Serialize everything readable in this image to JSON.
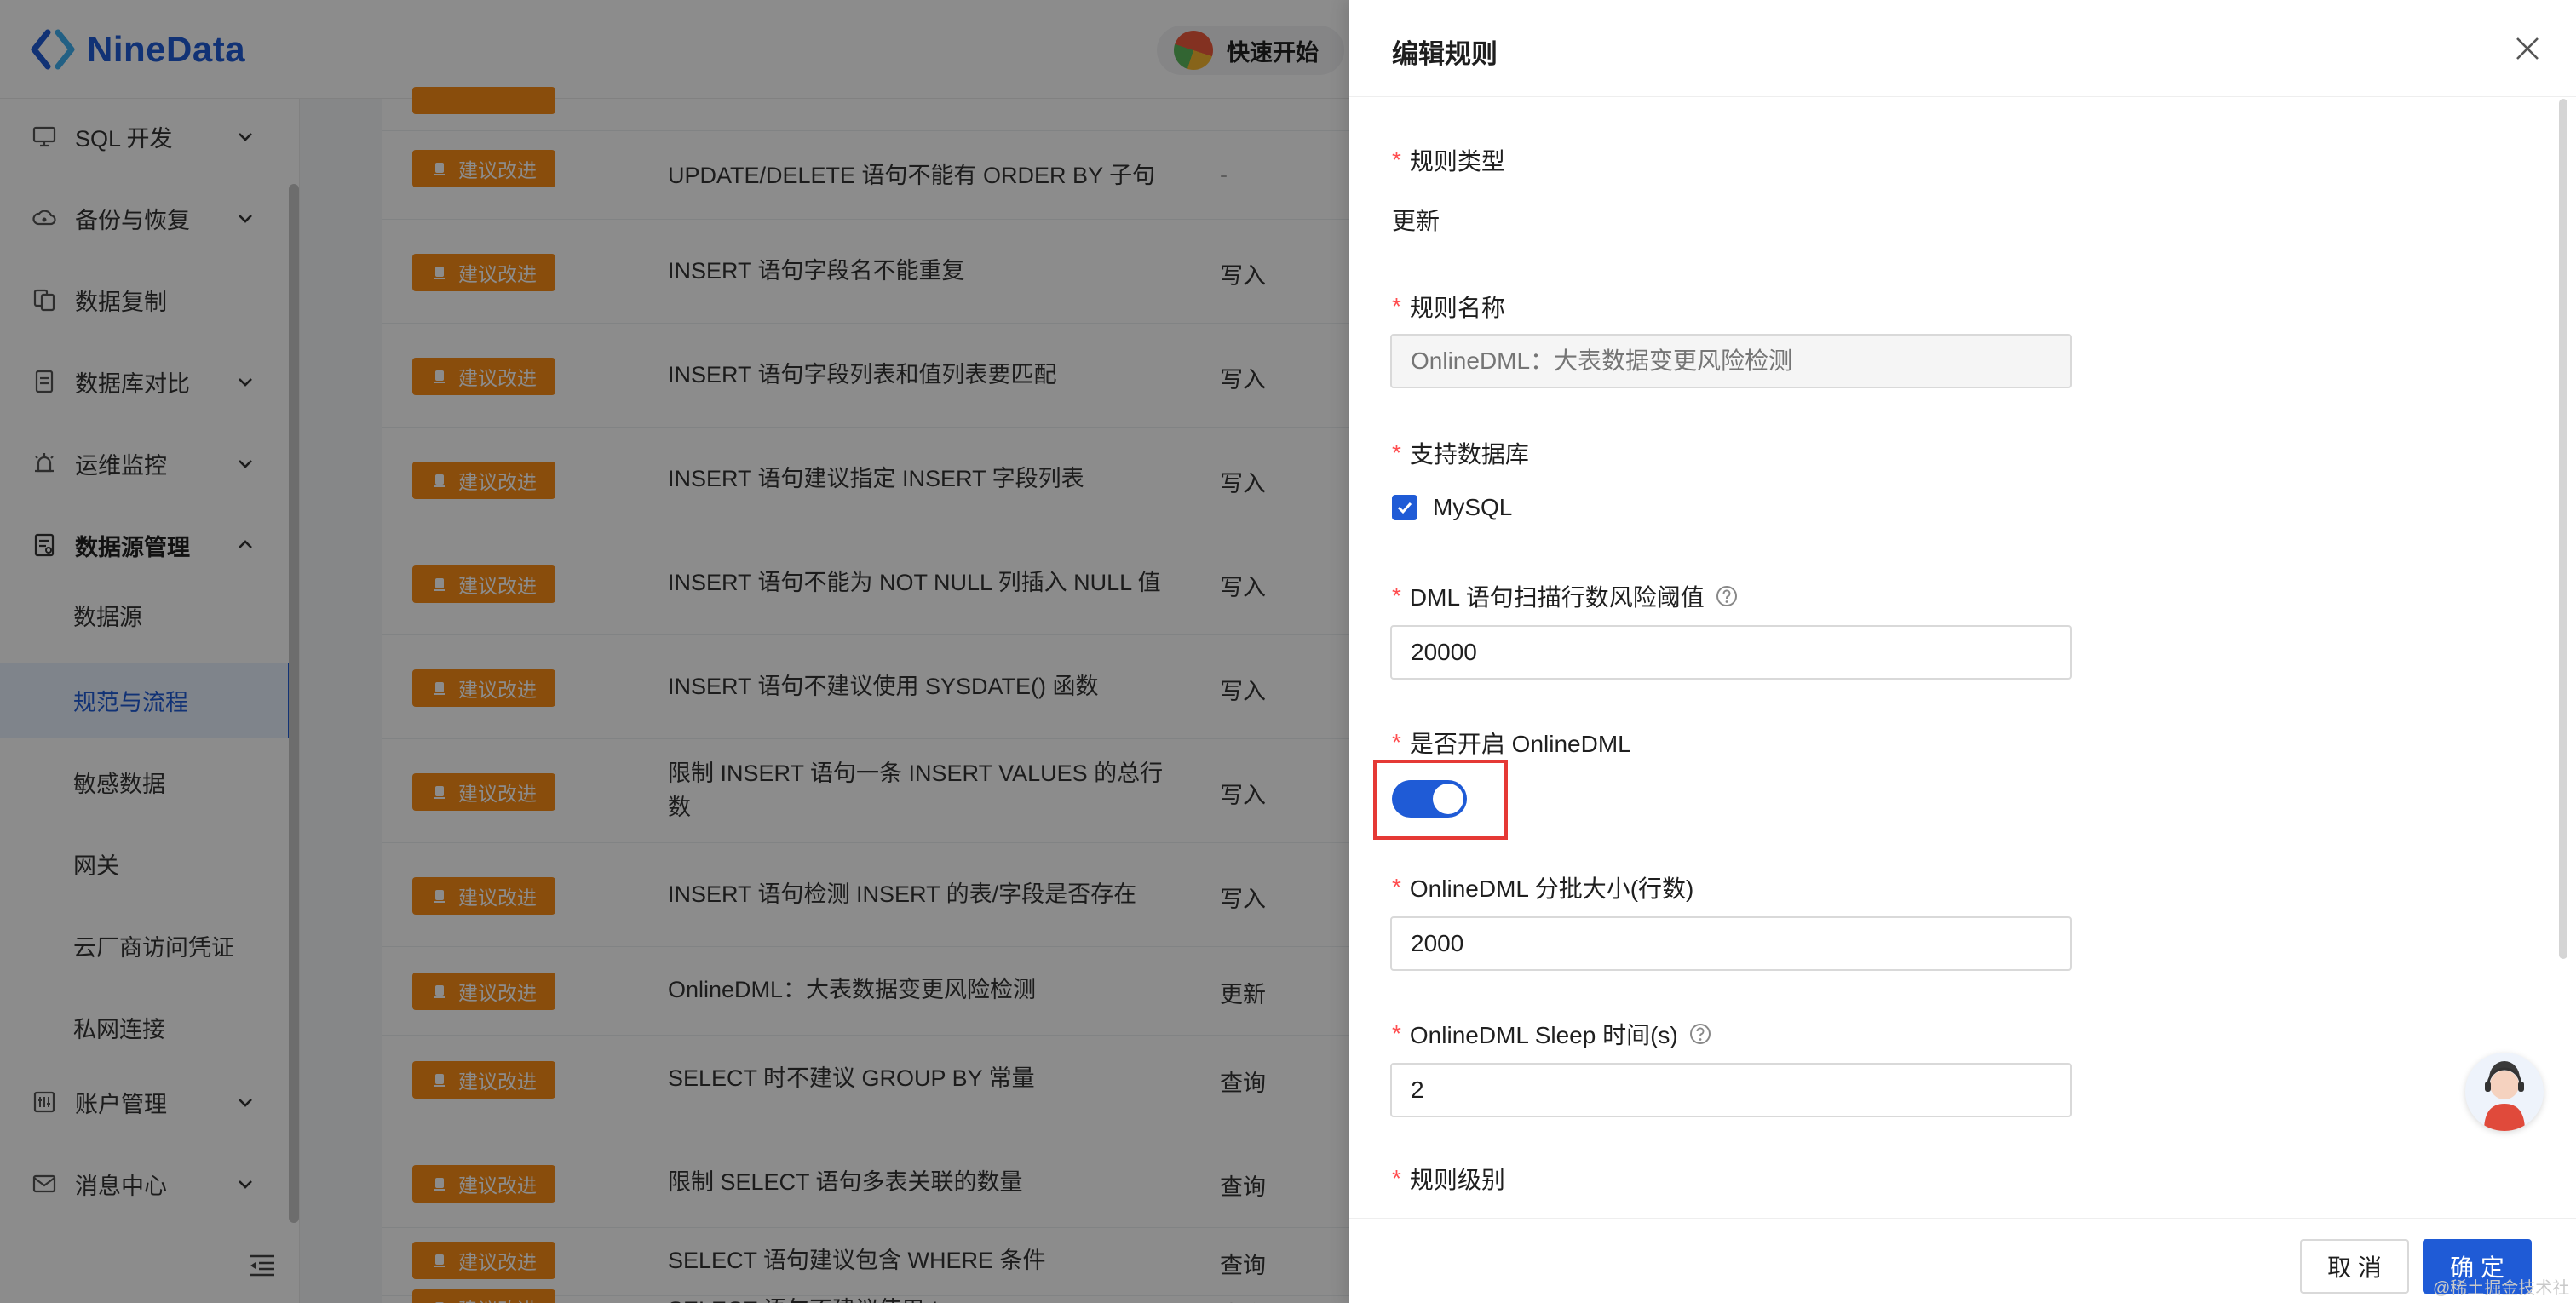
{
  "brand": {
    "name": "NineData"
  },
  "topbar": {
    "quick_start": "快速开始"
  },
  "sidebar": {
    "items": [
      {
        "label": "SQL 开发",
        "icon": "monitor-icon",
        "expandable": true
      },
      {
        "label": "备份与恢复",
        "icon": "cloud-icon",
        "expandable": true
      },
      {
        "label": "数据复制",
        "icon": "copy-icon",
        "expandable": false
      },
      {
        "label": "数据库对比",
        "icon": "compare-icon",
        "expandable": true
      },
      {
        "label": "运维监控",
        "icon": "alarm-icon",
        "expandable": true
      },
      {
        "label": "数据源管理",
        "icon": "datasource-icon",
        "expandable": true,
        "expanded": true
      }
    ],
    "sub_items": [
      "数据源",
      "规范与流程",
      "敏感数据",
      "网关",
      "云厂商访问凭证",
      "私网连接"
    ],
    "active_sub": "规范与流程",
    "bottom_items": [
      {
        "label": "账户管理",
        "icon": "account-icon"
      },
      {
        "label": "消息中心",
        "icon": "mail-icon"
      }
    ]
  },
  "rules_table": {
    "badge_label": "建议改进",
    "rows": [
      {
        "rule": "UPDATE/DELETE 语句不能有 ORDER BY 子句",
        "type": "-"
      },
      {
        "rule": "INSERT 语句字段名不能重复",
        "type": "写入"
      },
      {
        "rule": "INSERT 语句字段列表和值列表要匹配",
        "type": "写入"
      },
      {
        "rule": "INSERT 语句建议指定 INSERT 字段列表",
        "type": "写入"
      },
      {
        "rule": "INSERT 语句不能为 NOT NULL 列插入 NULL 值",
        "type": "写入"
      },
      {
        "rule": "INSERT 语句不建议使用 SYSDATE() 函数",
        "type": "写入"
      },
      {
        "rule": "限制 INSERT 语句一条 INSERT VALUES 的总行数",
        "type": "写入"
      },
      {
        "rule": "INSERT 语句检测 INSERT 的表/字段是否存在",
        "type": "写入"
      },
      {
        "rule": "OnlineDML：大表数据变更风险检测",
        "type": "更新"
      },
      {
        "rule": "SELECT 时不建议 GROUP BY 常量",
        "type": "查询"
      },
      {
        "rule": "限制 SELECT 语句多表关联的数量",
        "type": "查询"
      },
      {
        "rule": "SELECT 语句建议包含 WHERE 条件",
        "type": "查询"
      },
      {
        "rule": "SELECT 语句不建议使用 *",
        "type": "查询"
      }
    ]
  },
  "drawer": {
    "title": "编辑规则",
    "fields": {
      "rule_type": {
        "label": "规则类型",
        "value": "更新"
      },
      "rule_name": {
        "label": "规则名称",
        "placeholder": "OnlineDML：大表数据变更风险检测"
      },
      "supported_db": {
        "label": "支持数据库",
        "option": "MySQL",
        "checked": true
      },
      "scan_threshold": {
        "label": "DML 语句扫描行数风险阈值",
        "value": "20000"
      },
      "online_dml": {
        "label": "是否开启 OnlineDML",
        "enabled": true
      },
      "batch_size": {
        "label": "OnlineDML 分批大小(行数)",
        "value": "2000"
      },
      "sleep_time": {
        "label": "OnlineDML Sleep 时间(s)",
        "value": "2"
      },
      "rule_level": {
        "label": "规则级别"
      }
    },
    "buttons": {
      "cancel": "取 消",
      "ok": "确 定"
    }
  },
  "colors": {
    "primary": "#1f5bd6",
    "badge": "#fa8c16",
    "required": "#ff4d4f",
    "highlight": "#e53935"
  },
  "watermark": "@稀土掘金技术社区"
}
